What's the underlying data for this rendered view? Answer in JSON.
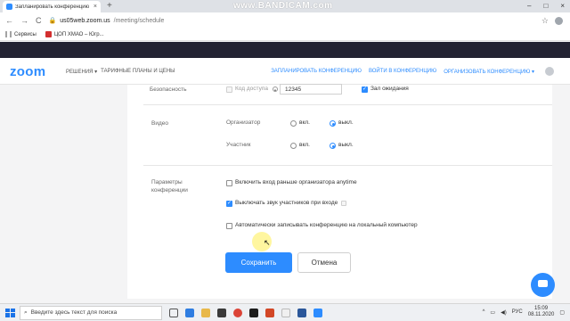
{
  "browser": {
    "tab_title": "Запланировать конференцию",
    "tab_close": "×",
    "new_tab": "+",
    "watermark": "www.BANDICAM.com",
    "window_controls": [
      "–",
      "□",
      "×"
    ],
    "nav_back": "←",
    "nav_forward": "→",
    "nav_reload": "C",
    "url_host": "us05web.zoom.us",
    "url_path": "/meeting/schedule",
    "bookmarks": [
      "Сервисы",
      "ЦОП ХМАО – Югр..."
    ]
  },
  "zoom_nav": {
    "logo": "zoom",
    "left_items": [
      "РЕШЕНИЯ ▾",
      "ТАРИФНЫЕ ПЛАНЫ И ЦЕНЫ"
    ],
    "right_items": [
      "ЗАПЛАНИРОВАТЬ КОНФЕРЕНЦИЮ",
      "ВОЙТИ В КОНФЕРЕНЦИЮ",
      "ОРГАНИЗОВАТЬ КОНФЕРЕНЦИЮ ▾"
    ]
  },
  "form": {
    "security": {
      "label": "Безопасность",
      "passcode_label": "Код доступа",
      "passcode_value": "12345",
      "waiting_room_label": "Зал ожидания"
    },
    "video": {
      "label": "Видео",
      "host_label": "Организатор",
      "participant_label": "Участник",
      "on_label": "вкл.",
      "off_label": "выкл."
    },
    "options": {
      "label_line1": "Параметры",
      "label_line2": "конференции",
      "join_before_host": "Включить вход раньше организатора anytime",
      "mute_on_entry": "Выключать звук участников при входе",
      "auto_record": "Автоматически записывать конференцию на локальный компьютер"
    },
    "save_button": "Сохранить",
    "cancel_button": "Отмена"
  },
  "taskbar": {
    "search_placeholder": "Введите здесь текст для поиска",
    "language": "РУС",
    "time": "15:09",
    "date": "08.11.2020"
  },
  "colors": {
    "accent": "#2d8cff",
    "dark_strip": "#232333"
  }
}
